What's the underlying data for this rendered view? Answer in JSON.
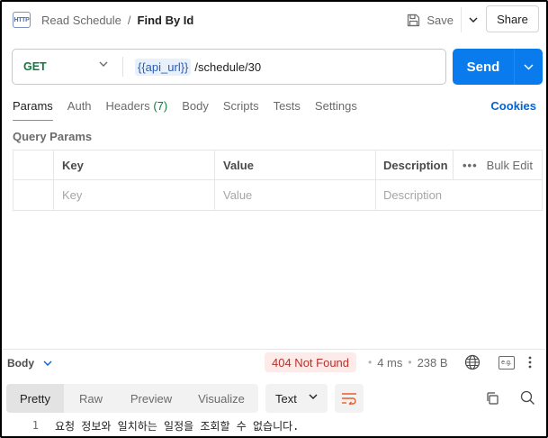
{
  "header": {
    "method_badge": "HTTP",
    "breadcrumb_parent": "Read Schedule",
    "breadcrumb_sep": "/",
    "breadcrumb_current": "Find By Id",
    "save_label": "Save",
    "share_label": "Share"
  },
  "request": {
    "method": "GET",
    "url_variable": "{{api_url}}",
    "url_path": "/schedule/30",
    "send_label": "Send"
  },
  "tabs": {
    "params": "Params",
    "auth": "Auth",
    "headers": "Headers",
    "headers_count": "(7)",
    "body": "Body",
    "scripts": "Scripts",
    "tests": "Tests",
    "settings": "Settings",
    "cookies": "Cookies"
  },
  "query_params": {
    "title": "Query Params",
    "columns": {
      "key": "Key",
      "value": "Value",
      "description": "Description",
      "bulk_edit": "Bulk Edit"
    },
    "placeholders": {
      "key": "Key",
      "value": "Value",
      "description": "Description"
    }
  },
  "response": {
    "body_label": "Body",
    "status": "404 Not Found",
    "time": "4 ms",
    "size": "238 B",
    "example_badge": "e.g.",
    "view_tabs": [
      "Pretty",
      "Raw",
      "Preview",
      "Visualize"
    ],
    "active_view": "Pretty",
    "format": "Text",
    "lines": [
      {
        "number": "1",
        "text": "요청 정보와 일치하는 일정을 조회할 수 없습니다."
      }
    ]
  },
  "colors": {
    "accent_send": "#097bed",
    "status_bg": "#fdebe9",
    "status_text": "#b4322c",
    "active_tab_underline": "#f26b3a",
    "method_get": "#0f7a3d",
    "cookies_link": "#0265d2"
  }
}
